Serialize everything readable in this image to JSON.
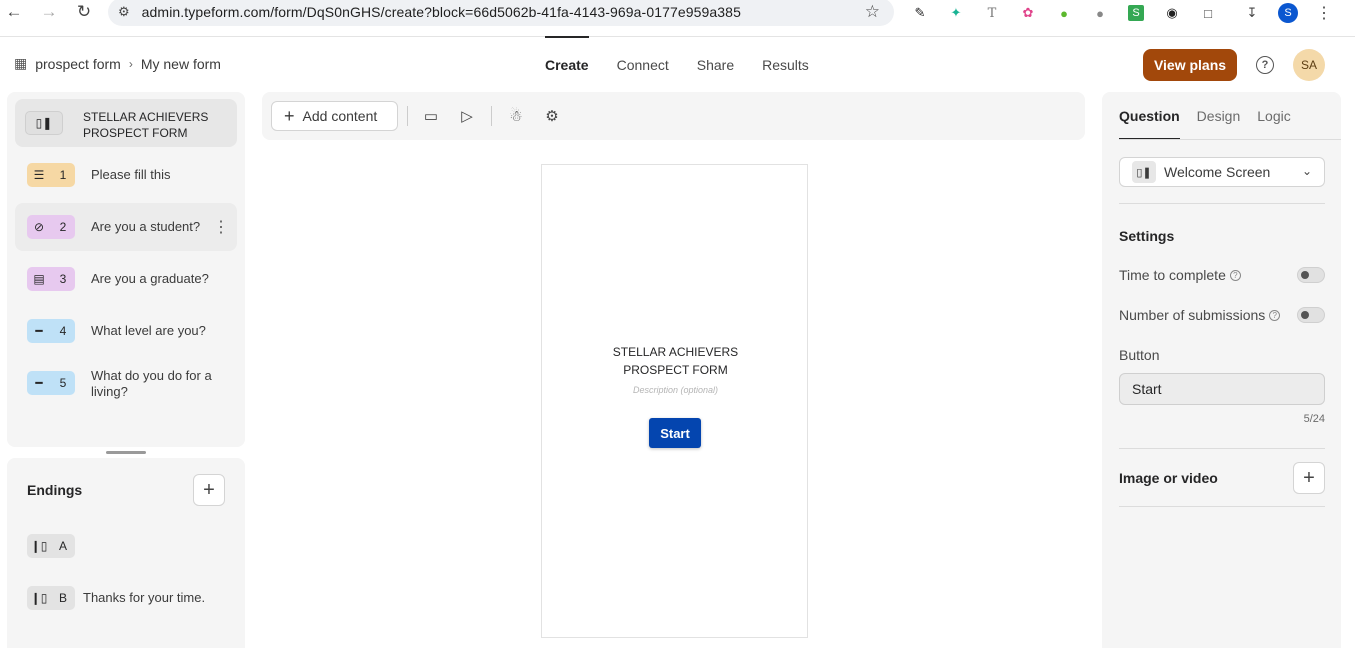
{
  "browser": {
    "url": "admin.typeform.com/form/DqS0nGHS/create?block=66d5062b-41fa-4143-969a-0177e959a385",
    "profile_initial": "S"
  },
  "header": {
    "workspace": "prospect form",
    "form_name": "My new form",
    "tabs": [
      {
        "label": "Create",
        "active": true
      },
      {
        "label": "Connect",
        "active": false
      },
      {
        "label": "Share",
        "active": false
      },
      {
        "label": "Results",
        "active": false
      }
    ],
    "view_plans": "View plans",
    "help": "?",
    "avatar": "SA"
  },
  "questions": {
    "welcome_line1": "STELLAR ACHIEVERS",
    "welcome_line2": "PROSPECT FORM",
    "items": [
      {
        "num": "1",
        "label": "Please fill this",
        "icon": "contact-info-icon",
        "color": "#f6d8a4"
      },
      {
        "num": "2",
        "label": "Are you a student?",
        "icon": "yes-no-icon",
        "color": "#e7c9ef"
      },
      {
        "num": "3",
        "label": "Are you a graduate?",
        "icon": "multiple-choice-icon",
        "color": "#e7c9ef"
      },
      {
        "num": "4",
        "label": "What level are you?",
        "icon": "short-text-icon",
        "color": "#bfe1f7"
      },
      {
        "num": "5",
        "label": "What do you do for a living?",
        "icon": "short-text-icon",
        "color": "#bfe1f7"
      }
    ]
  },
  "endings": {
    "title": "Endings",
    "items": [
      {
        "letter": "A",
        "label": ""
      },
      {
        "letter": "B",
        "label": "Thanks for your time."
      }
    ]
  },
  "toolbar": {
    "add_content": "Add content"
  },
  "preview": {
    "title_line1": "STELLAR ACHIEVERS",
    "title_line2": "PROSPECT FORM",
    "description_placeholder": "Description (optional)",
    "start_button": "Start",
    "button_color": "#0445af"
  },
  "right_panel": {
    "tabs": [
      {
        "label": "Question",
        "active": true
      },
      {
        "label": "Design",
        "active": false
      },
      {
        "label": "Logic",
        "active": false
      }
    ],
    "type_select": "Welcome Screen",
    "settings_title": "Settings",
    "time_to_complete": "Time to complete",
    "number_of_submissions": "Number of submissions",
    "button_label": "Button",
    "button_value": "Start",
    "char_counter": "5/24",
    "image_or_video": "Image or video"
  },
  "colors": {
    "view_plans_bg": "#a2480b",
    "avatar_bg": "#f4d9a9"
  }
}
